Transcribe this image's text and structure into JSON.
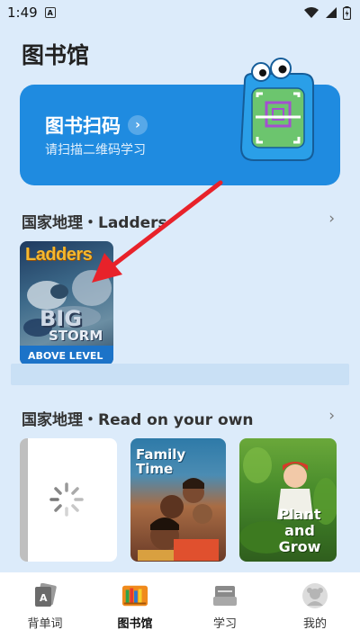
{
  "status_bar": {
    "time": "1:49",
    "notification_icon": "a-square-icon"
  },
  "page": {
    "title": "图书馆"
  },
  "scan_card": {
    "title": "图书扫码",
    "subtitle": "请扫描二维码学习",
    "chevron": "›"
  },
  "sections": [
    {
      "title": "国家地理・Ladders",
      "chevron": "›",
      "books": [
        {
          "logo": "Ladders",
          "title_line1": "BIG",
          "title_line2": "STORM",
          "level": "ABOVE LEVEL"
        }
      ]
    },
    {
      "title": "国家地理・Read on your own",
      "chevron": "›",
      "books": [
        {
          "state": "loading"
        },
        {
          "title": "Family Time"
        },
        {
          "title": "Plant and Grow"
        }
      ]
    }
  ],
  "bottom_nav": [
    {
      "label": "背单词",
      "icon": "flashcard-icon",
      "active": false
    },
    {
      "label": "图书馆",
      "icon": "bookshelf-icon",
      "active": true
    },
    {
      "label": "学习",
      "icon": "study-icon",
      "active": false
    },
    {
      "label": "我的",
      "icon": "avatar-icon",
      "active": false
    }
  ],
  "colors": {
    "accent": "#1f8be0",
    "background": "#dcebfa",
    "arrow": "#e8222a"
  }
}
